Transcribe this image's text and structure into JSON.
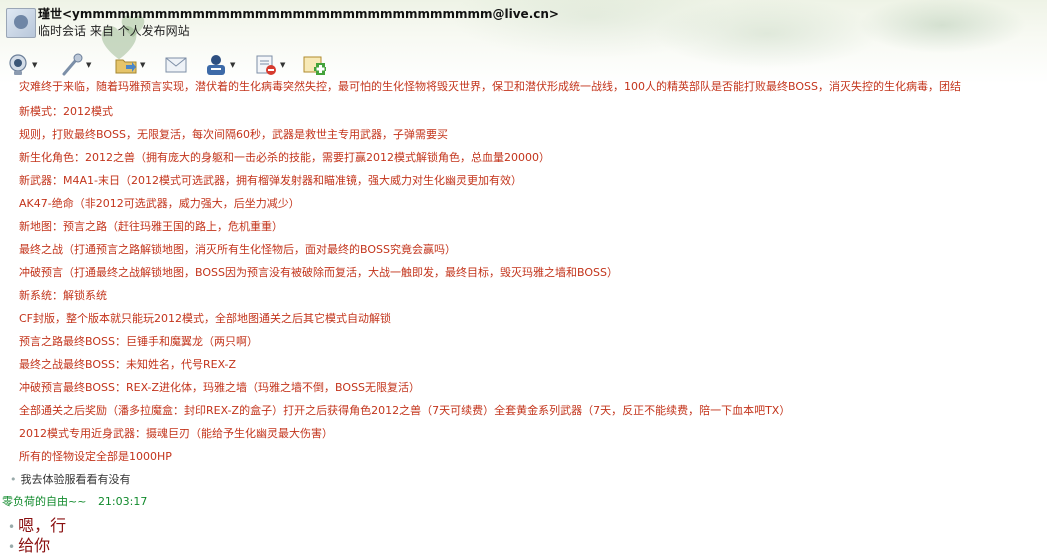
{
  "header": {
    "contact_name": "瑾世<ymmmmmmmmmmmmmmmmmmmmmmmmmmmmmmmmm@live.cn>",
    "status": "临时会话 来自 个人发布网站"
  },
  "toolbar": {
    "items": [
      {
        "icon": "video-camera-icon"
      },
      {
        "icon": "microphone-icon"
      },
      {
        "icon": "folder-send-icon"
      },
      {
        "icon": "email-icon"
      },
      {
        "icon": "contact-card-icon"
      },
      {
        "icon": "block-icon"
      },
      {
        "icon": "add-contact-icon"
      }
    ]
  },
  "messages": {
    "clipped_line": "灾难终于来临，随着玛雅预言实现，潜伏着的生化病毒突然失控，最可怕的生化怪物将毁灭世界，保卫和潜伏形成统一战线，100人的精英部队是否能打败最终BOSS，消灭失控的生化病毒，团结",
    "lines": [
      "新模式：2012模式",
      "规则，打败最终BOSS，无限复活，每次间隔60秒，武器是救世主专用武器，子弹需要买",
      "新生化角色：2012之兽（拥有庞大的身躯和一击必杀的技能，需要打赢2012模式解锁角色，总血量20000）",
      "新武器：M4A1-末日（2012模式可选武器，拥有榴弹发射器和瞄准镜，强大威力对生化幽灵更加有效）",
      "AK47-绝命（非2012可选武器，威力强大，后坐力减少）",
      "新地图：预言之路（赶往玛雅王国的路上，危机重重）",
      "最终之战（打通预言之路解锁地图，消灭所有生化怪物后，面对最终的BOSS究竟会赢吗）",
      "冲破预言（打通最终之战解锁地图，BOSS因为预言没有被破除而复活，大战一触即发，最终目标，毁灭玛雅之墙和BOSS）",
      "新系统：解锁系统",
      "CF封版，整个版本就只能玩2012模式，全部地图通关之后其它模式自动解锁",
      "预言之路最终BOSS：巨锤手和魔翼龙（两只啊）",
      "最终之战最终BOSS：未知姓名，代号REX-Z",
      "冲破预言最终BOSS：REX-Z进化体，玛雅之墙（玛雅之墙不倒，BOSS无限复活）",
      "全部通关之后奖励（潘多拉魔盒：封印REX-Z的盒子）打开之后获得角色2012之兽（7天可续费）全套黄金系列武器（7天，反正不能续费，陪一下血本吧TX）",
      "2012模式专用近身武器：摄魂巨刃（能给予生化幽灵最大伤害）",
      "所有的怪物设定全部是1000HP"
    ],
    "follow_up": "我去体验服看看有没有",
    "sender": "零负荷的自由~~",
    "time": "21:03:17",
    "reply_1": "嗯，行",
    "reply_2": "给你"
  },
  "colors": {
    "message_red": "#c3341b",
    "sender_green": "#118a2c",
    "reply_dark_red": "#8a1010"
  }
}
